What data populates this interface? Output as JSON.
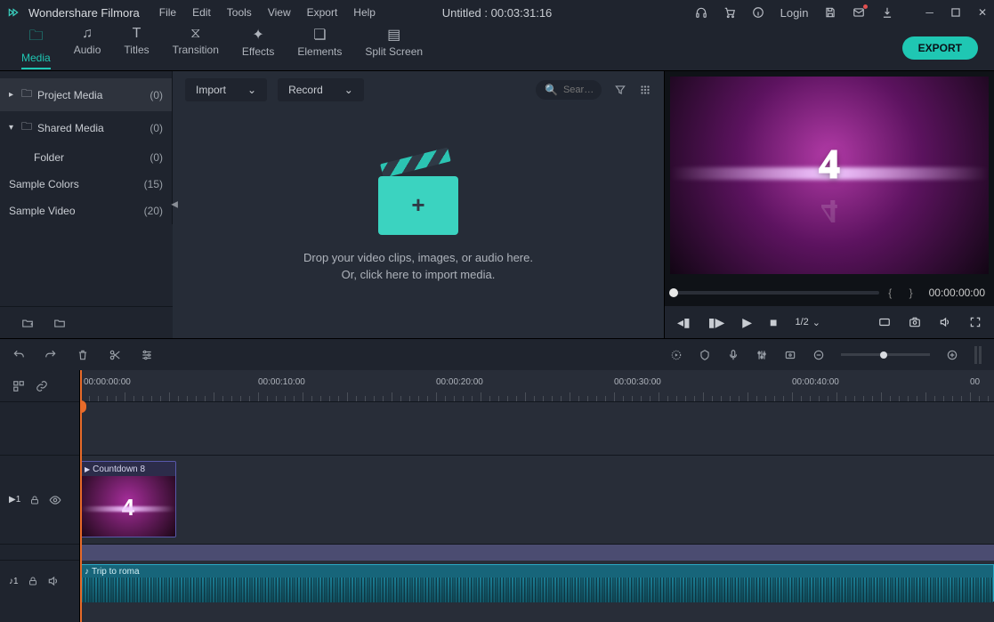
{
  "app": {
    "name": "Wondershare Filmora"
  },
  "titlebar": {
    "menus": [
      "File",
      "Edit",
      "Tools",
      "View",
      "Export",
      "Help"
    ],
    "center": "Untitled : 00:03:31:16",
    "login": "Login"
  },
  "tabs": {
    "items": [
      "Media",
      "Audio",
      "Titles",
      "Transition",
      "Effects",
      "Elements",
      "Split Screen"
    ],
    "active_index": 0,
    "export_button": "EXPORT"
  },
  "sidebar": {
    "items": [
      {
        "label": "Project Media",
        "count": "(0)",
        "active": true,
        "expandable": true,
        "open": true,
        "folder": true
      },
      {
        "label": "Shared Media",
        "count": "(0)",
        "active": false,
        "expandable": true,
        "open": false,
        "folder": true
      },
      {
        "label": "Folder",
        "count": "(0)",
        "active": false,
        "indent": true
      },
      {
        "label": "Sample Colors",
        "count": "(15)",
        "active": false
      },
      {
        "label": "Sample Video",
        "count": "(20)",
        "active": false
      }
    ]
  },
  "media": {
    "import_label": "Import",
    "record_label": "Record",
    "search_placeholder": "Sear…",
    "drop_line1": "Drop your video clips, images, or audio here.",
    "drop_line2": "Or, click here to import media."
  },
  "preview": {
    "number": "4",
    "time": "00:00:00:00",
    "zoom": "1/2"
  },
  "timeline": {
    "ruler": [
      "00:00:00:00",
      "00:00:10:00",
      "00:00:20:00",
      "00:00:30:00",
      "00:00:40:00",
      "00"
    ],
    "video_track_label": "1",
    "audio_track_label": "1",
    "video_clip_name": "Countdown 8",
    "audio_clip_name": "Trip to roma"
  }
}
